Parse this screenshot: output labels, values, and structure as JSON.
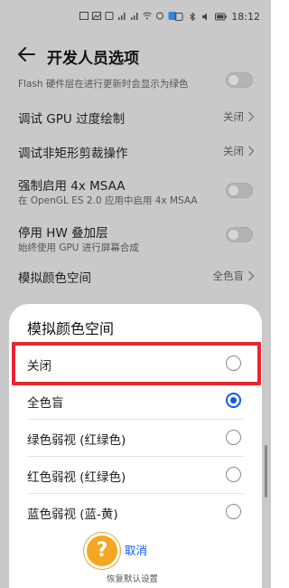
{
  "status_bar": {
    "time": "18:12"
  },
  "header": {
    "title": "开发人员选项"
  },
  "list": {
    "partial_text": "Flash 硬件层在进行更新时会显示为绿色",
    "items": [
      {
        "title": "调试 GPU 过度绘制",
        "value": "关闭"
      },
      {
        "title": "调试非矩形剪裁操作",
        "value": "关闭"
      },
      {
        "title": "强制启用 4x MSAA",
        "subtitle": "在 OpenGL ES 2.0 应用中启用 4x MSAA"
      },
      {
        "title": "停用 HW 叠加层",
        "subtitle": "始终使用 GPU 进行屏幕合成"
      },
      {
        "title": "模拟颜色空间",
        "value": "全色盲"
      }
    ]
  },
  "dialog": {
    "title": "模拟颜色空间",
    "options": [
      {
        "label": "关闭",
        "selected": false
      },
      {
        "label": "全色盲",
        "selected": true
      },
      {
        "label": "绿色弱视 (红绿色)",
        "selected": false
      },
      {
        "label": "红色弱视 (红绿色)",
        "selected": false
      },
      {
        "label": "蓝色弱视 (蓝-黄)",
        "selected": false
      }
    ],
    "cancel_label": "取消",
    "help_glyph": "?",
    "bottom_hint": "恢复默认设置"
  },
  "colors": {
    "accent": "#0a59f7",
    "highlight": "#e8262f",
    "help": "#f5a623"
  }
}
